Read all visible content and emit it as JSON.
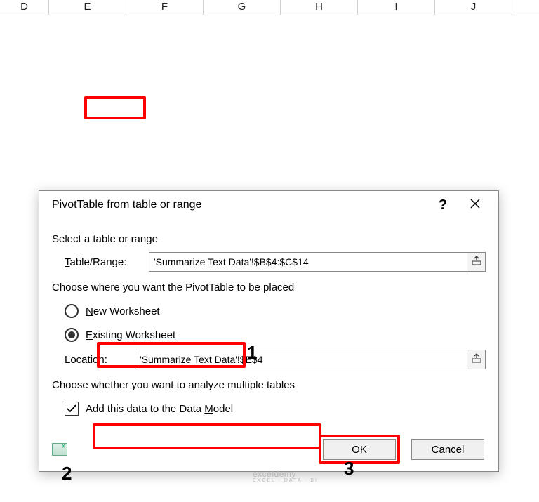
{
  "columns": [
    "D",
    "E",
    "F",
    "G",
    "H",
    "I",
    "J"
  ],
  "dialog": {
    "title": "PivotTable from table or range",
    "section_select": "Select a table or range",
    "table_range_label": "Table/Range:",
    "table_range_value": "'Summarize Text Data'!$B$4:$C$14",
    "section_placement": "Choose where you want the PivotTable to be placed",
    "new_worksheet_label": "New Worksheet",
    "existing_worksheet_label": "Existing Worksheet",
    "location_label": "Location:",
    "location_value": "'Summarize Text Data'!$E$4",
    "section_analyze": "Choose whether you want to analyze multiple tables",
    "add_data_model_label": "Add this data to the Data Model",
    "ok_label": "OK",
    "cancel_label": "Cancel",
    "help_label": "?"
  },
  "callouts": {
    "c1": "1",
    "c2": "2",
    "c3": "3"
  },
  "watermark": {
    "main": "exceldemy",
    "sub": "EXCEL · DATA · BI"
  }
}
